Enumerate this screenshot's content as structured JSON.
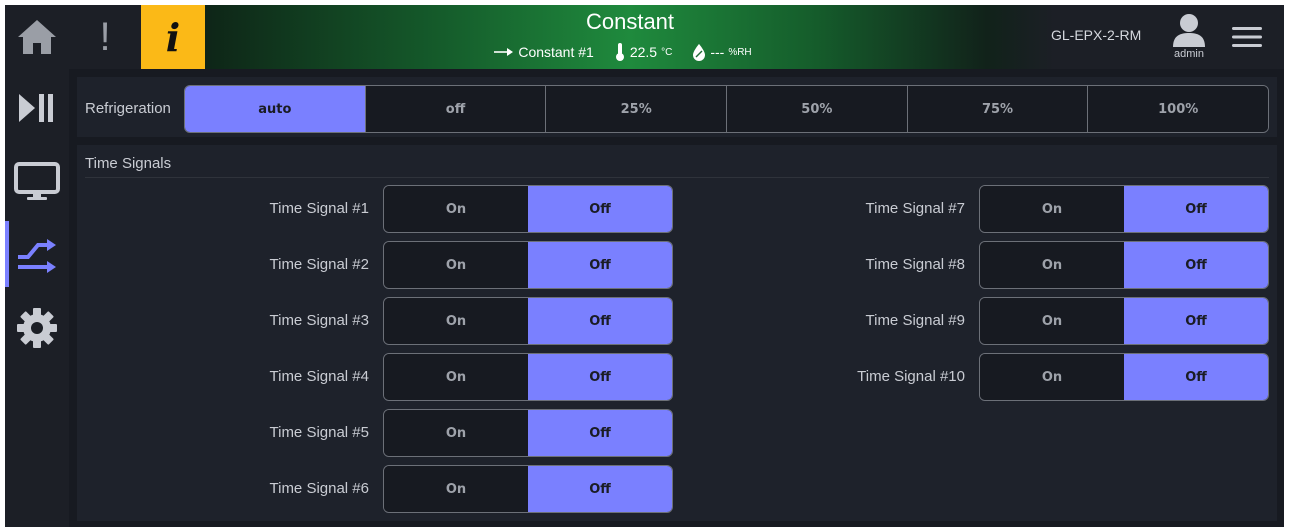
{
  "header": {
    "title": "Constant",
    "program": "Constant #1",
    "temperature": "22.5",
    "temperature_unit": "°C",
    "humidity": "---",
    "humidity_unit": "%RH",
    "device": "GL-EPX-2-RM",
    "user": "admin"
  },
  "sidebar": {
    "items": [
      {
        "icon": "play-pause-icon",
        "active": false
      },
      {
        "icon": "monitor-icon",
        "active": false
      },
      {
        "icon": "signals-icon",
        "active": true
      },
      {
        "icon": "settings-icon",
        "active": false
      }
    ]
  },
  "refrigeration": {
    "label": "Refrigeration",
    "options": [
      "auto",
      "off",
      "25%",
      "50%",
      "75%",
      "100%"
    ],
    "selected": "auto"
  },
  "time_signals": {
    "title": "Time Signals",
    "on_label": "On",
    "off_label": "Off",
    "left": [
      {
        "label": "Time Signal #1",
        "state": "Off"
      },
      {
        "label": "Time Signal #2",
        "state": "Off"
      },
      {
        "label": "Time Signal #3",
        "state": "Off"
      },
      {
        "label": "Time Signal #4",
        "state": "Off"
      },
      {
        "label": "Time Signal #5",
        "state": "Off"
      },
      {
        "label": "Time Signal #6",
        "state": "Off"
      }
    ],
    "right": [
      {
        "label": "Time Signal #7",
        "state": "Off"
      },
      {
        "label": "Time Signal #8",
        "state": "Off"
      },
      {
        "label": "Time Signal #9",
        "state": "Off"
      },
      {
        "label": "Time Signal #10",
        "state": "Off"
      }
    ]
  },
  "colors": {
    "accent": "#7a80ff",
    "warning": "#fbb917",
    "background": "#171a21",
    "panel": "#1e222b"
  }
}
